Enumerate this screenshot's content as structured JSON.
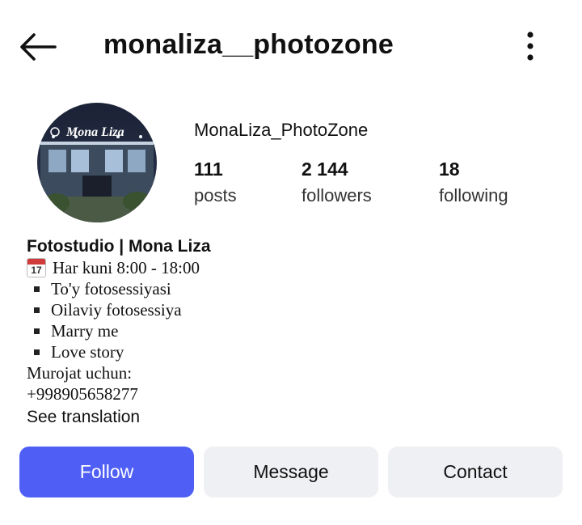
{
  "header": {
    "username": "monaliza__photozone",
    "back_icon": "arrow-left-icon",
    "more_icon": "more-vertical-icon"
  },
  "profile": {
    "avatar_text": "Mona Liza",
    "display_name": "MonaLiza_PhotoZone",
    "stats": [
      {
        "value": "111",
        "label": "posts"
      },
      {
        "value": "2 144",
        "label": "followers"
      },
      {
        "value": "18",
        "label": "following"
      }
    ]
  },
  "bio": {
    "name": "Fotostudio | Mona Liza",
    "calendar_day": "17",
    "hours": "Har kuni 8:00 - 18:00",
    "services": [
      "To'y fotosessiyasi",
      "Oilaviy fotosessiya",
      "Marry me",
      "Love story"
    ],
    "contact_label": "Murojat uchun:",
    "phone": "+998905658277",
    "see_translation": "See translation"
  },
  "actions": {
    "follow": "Follow",
    "message": "Message",
    "contact": "Contact"
  },
  "colors": {
    "follow_bg": "#4f5ff5",
    "secondary_bg": "#eff0f3"
  }
}
